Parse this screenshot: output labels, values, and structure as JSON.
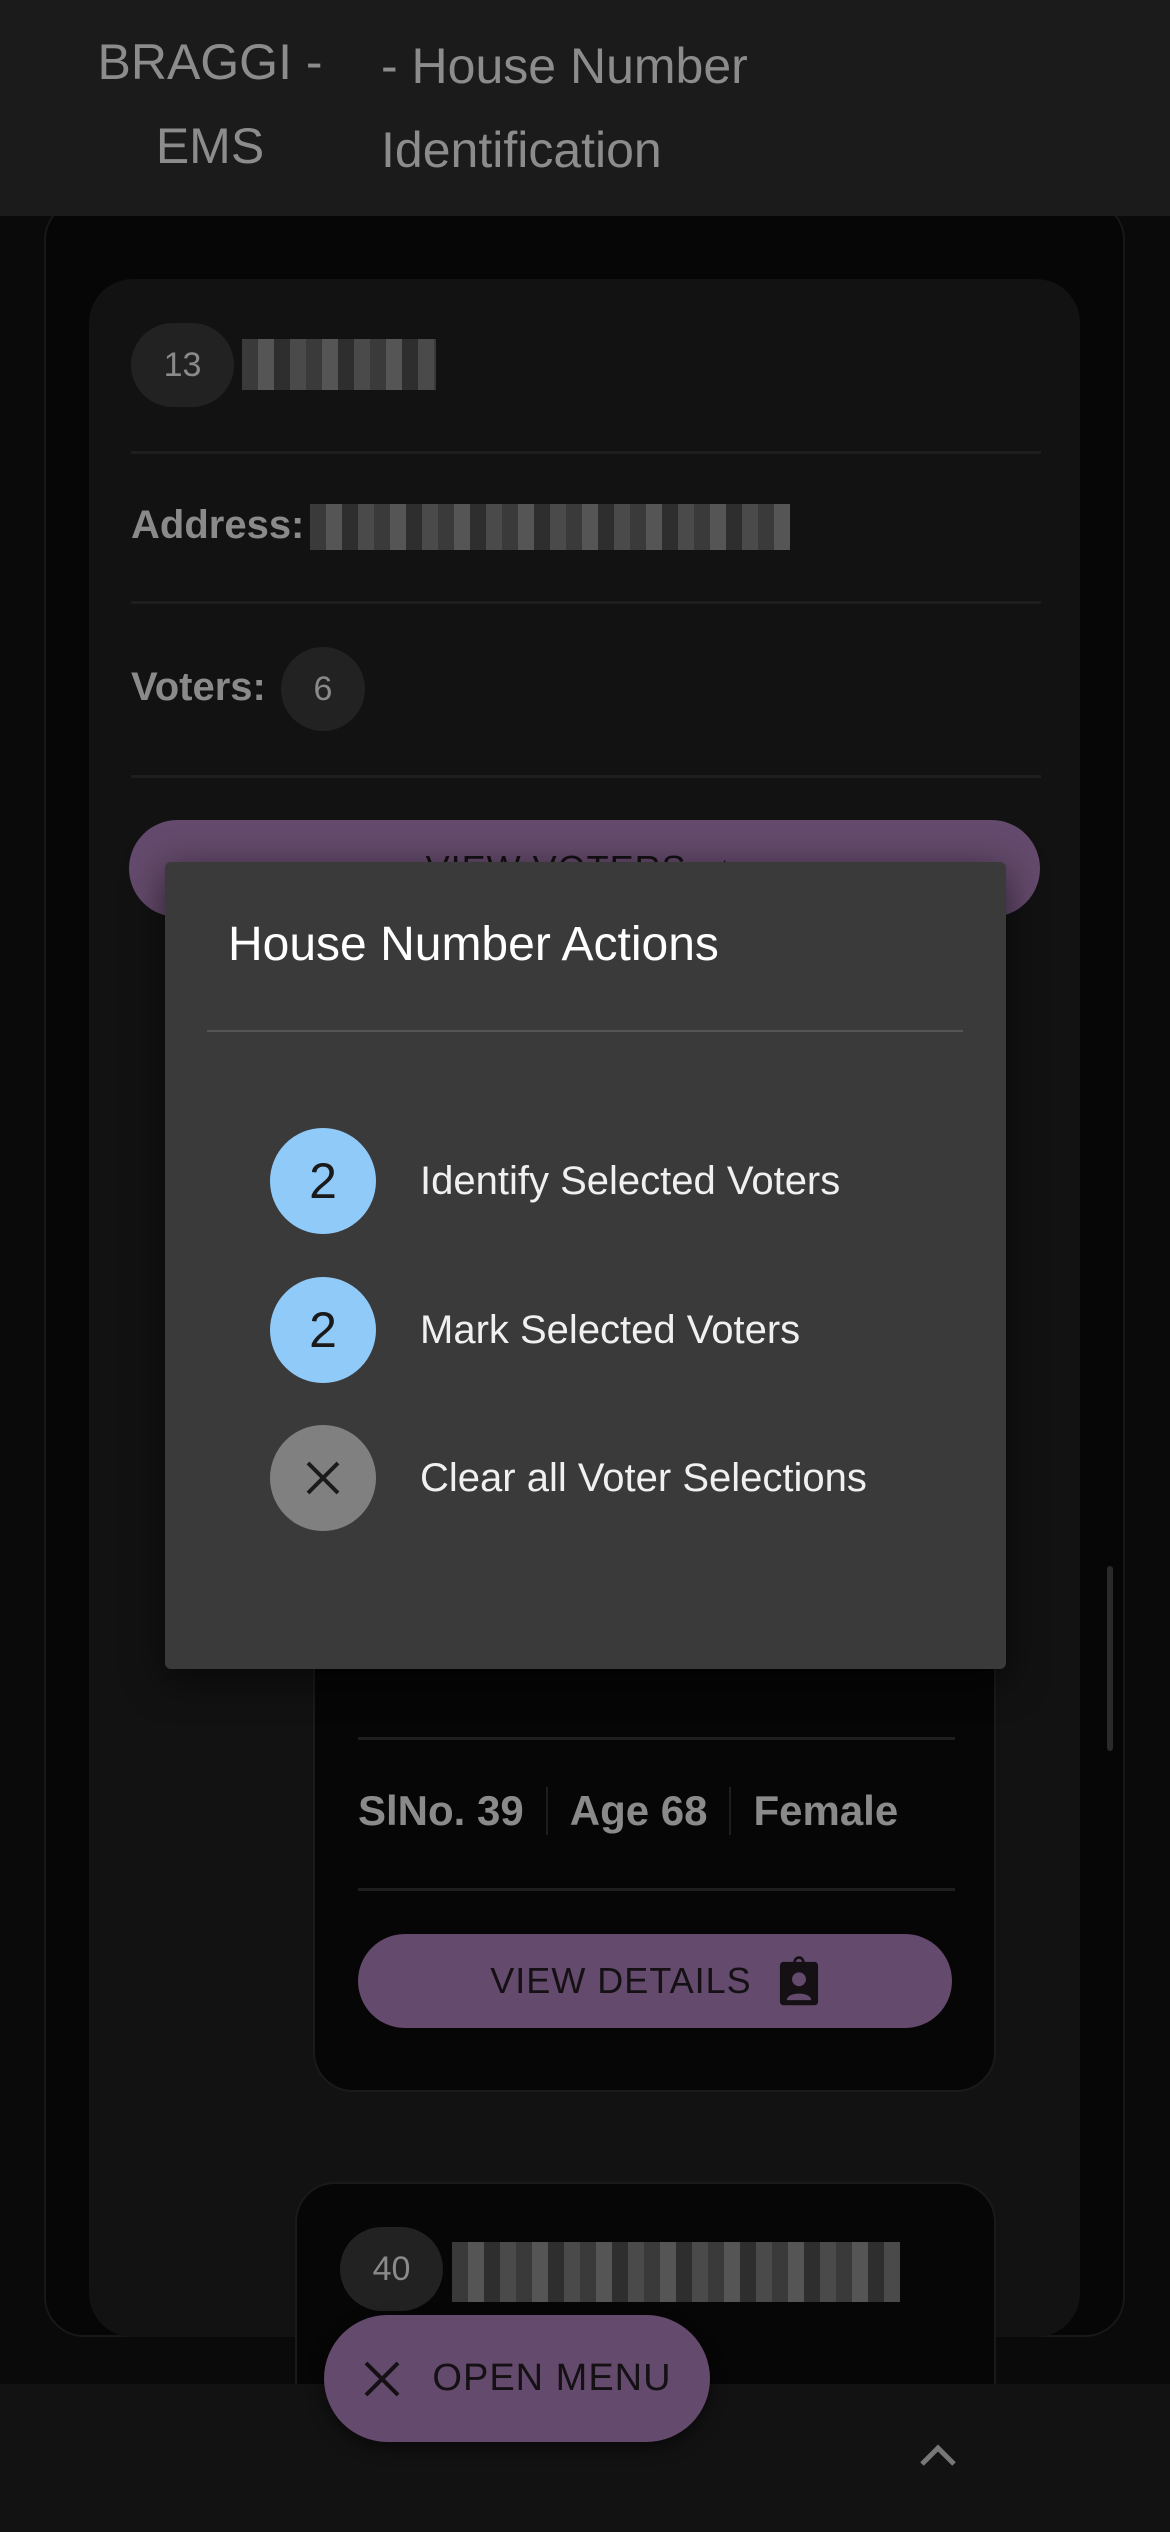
{
  "header": {
    "app_title_line1": "BRAGGI -",
    "app_title_line2": "EMS",
    "page_title_line1": "- House Number",
    "page_title_line2": "Identification"
  },
  "house_card": {
    "house_no": "13",
    "address_label": "Address:",
    "voters_label": "Voters:",
    "voters_count": "6",
    "view_voters_label": "VIEW VOTERS"
  },
  "voter_card": {
    "slno": "SlNo. 39",
    "age": "Age 68",
    "gender": "Female",
    "view_details_label": "VIEW DETAILS"
  },
  "next_card": {
    "serial": "40"
  },
  "fab": {
    "label": "OPEN MENU",
    "icon": "close-icon"
  },
  "dialog": {
    "title": "House Number Actions",
    "items": [
      {
        "badge": "2",
        "label": "Identify Selected Voters",
        "color": "#90caf9"
      },
      {
        "badge": "2",
        "label": "Mark Selected Voters",
        "color": "#90caf9"
      },
      {
        "badge": "",
        "label": "Clear all Voter Selections",
        "color": "#808080",
        "icon": "close-icon"
      }
    ]
  },
  "colors": {
    "accent": "#644a6c",
    "badge": "#90caf9"
  }
}
